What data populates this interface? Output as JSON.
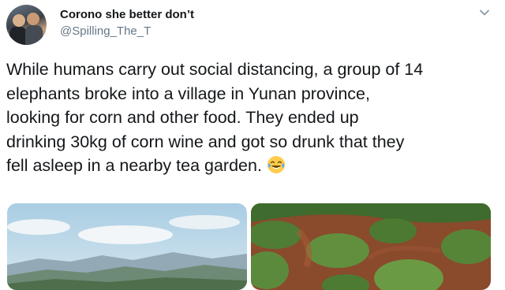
{
  "tweet": {
    "display_name": "Corono she better don’t",
    "handle": "@Spilling_The_T",
    "lines": [
      "While humans carry out social distancing, a group of 14",
      "elephants broke into a village in Yunan province,",
      "looking for corn and other food. They ended up",
      "drinking 30kg of corn wine and got so drunk that they",
      "fell asleep in a nearby tea garden."
    ],
    "emoji": "face-with-tears-of-joy-icon",
    "menu_icon": "chevron-down-icon",
    "media": [
      {
        "name": "mountain-landscape-photo"
      },
      {
        "name": "tea-garden-photo"
      }
    ]
  },
  "colors": {
    "text": "#14171a",
    "secondary": "#657786"
  }
}
